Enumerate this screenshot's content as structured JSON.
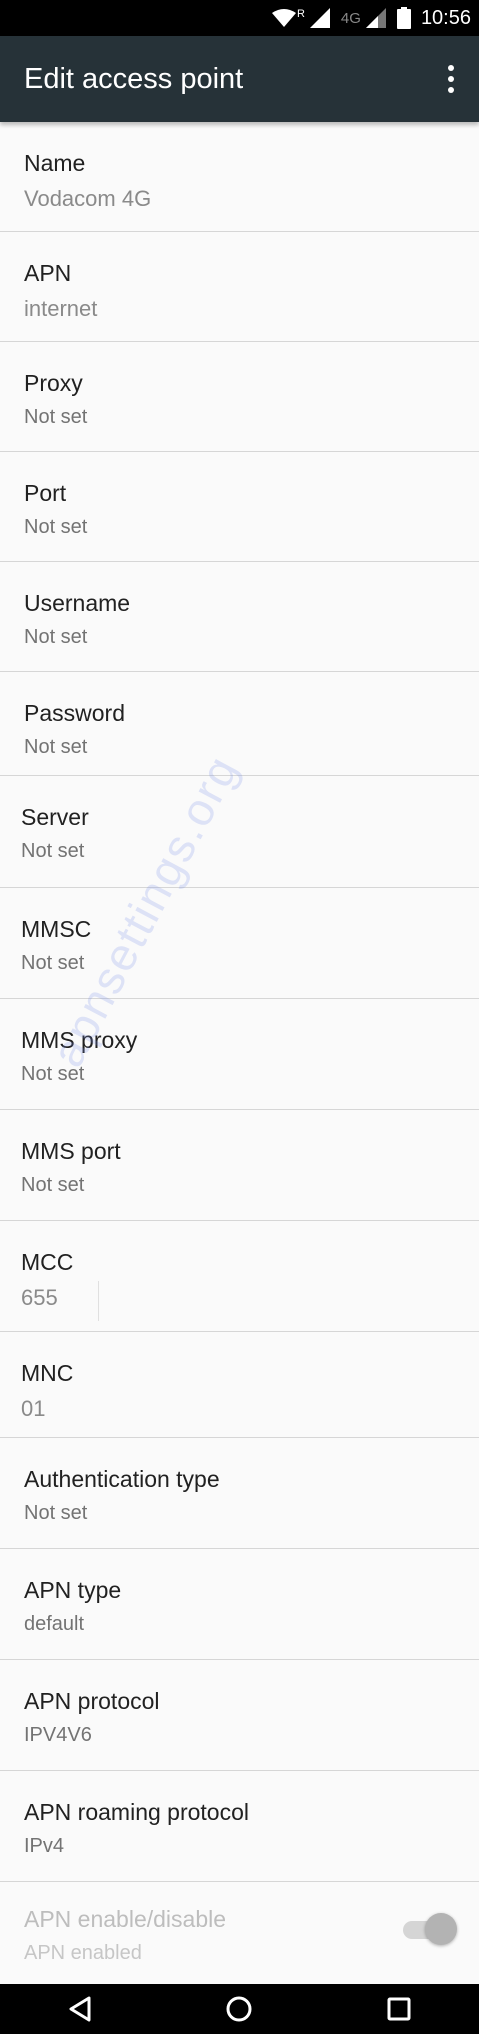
{
  "status_bar": {
    "roaming": "R",
    "network": "4G",
    "time": "10:56"
  },
  "app_bar": {
    "title": "Edit access point",
    "menu_icon": "overflow-menu-icon"
  },
  "fields": [
    {
      "label": "Name",
      "value": "Vodacom 4G"
    },
    {
      "label": "APN",
      "value": "internet"
    },
    {
      "label": "Proxy",
      "value": "Not set"
    },
    {
      "label": "Port",
      "value": "Not set"
    },
    {
      "label": "Username",
      "value": "Not set"
    },
    {
      "label": "Password",
      "value": "Not set"
    },
    {
      "label": "Server",
      "value": "Not set"
    },
    {
      "label": "MMSC",
      "value": "Not set"
    },
    {
      "label": "MMS proxy",
      "value": "Not set"
    },
    {
      "label": "MMS port",
      "value": "Not set"
    },
    {
      "label": "MCC",
      "value": "655"
    },
    {
      "label": "MNC",
      "value": "01"
    },
    {
      "label": "Authentication type",
      "value": "Not set"
    },
    {
      "label": "APN type",
      "value": "default"
    },
    {
      "label": "APN protocol",
      "value": "IPV4V6"
    },
    {
      "label": "APN roaming protocol",
      "value": "IPv4"
    },
    {
      "label": "APN enable/disable",
      "value": "APN enabled",
      "enabled": true
    }
  ],
  "watermark": "apnsettings.org",
  "nav_bar": {
    "back_icon": "back-icon",
    "home_icon": "home-icon",
    "recents_icon": "recents-icon"
  }
}
